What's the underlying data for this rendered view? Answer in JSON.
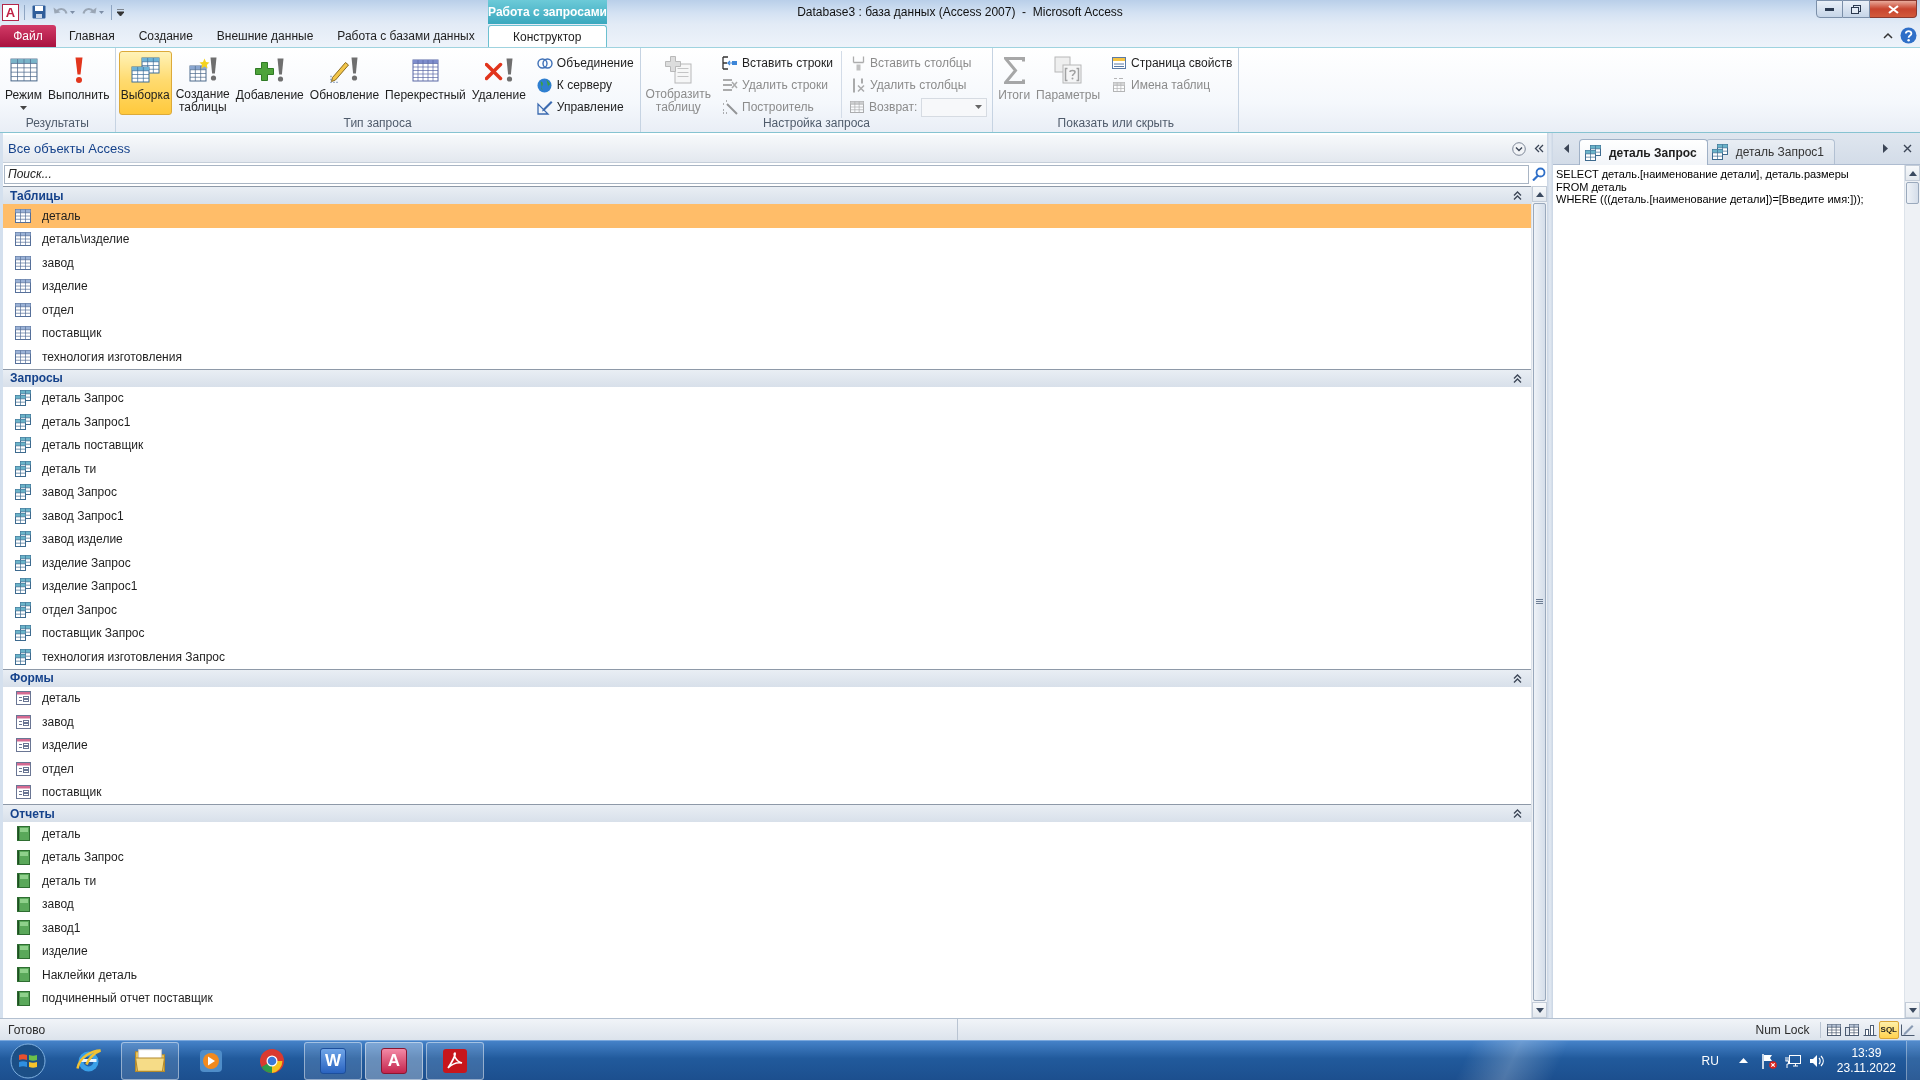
{
  "window": {
    "title": "Database3 : база данных (Access 2007)  -  Microsoft Access",
    "app_letter": "A"
  },
  "quick_access": [
    {
      "kind": "save",
      "disabled": false
    },
    {
      "kind": "undo",
      "disabled": true
    },
    {
      "kind": "redo",
      "disabled": true
    }
  ],
  "contextual_tab_group": {
    "label": "Работа с запросами"
  },
  "ribbon_tabs": [
    {
      "label": "Файл",
      "kind": "file",
      "selected": false
    },
    {
      "label": "Главная",
      "kind": "normal",
      "selected": false
    },
    {
      "label": "Создание",
      "kind": "normal",
      "selected": false
    },
    {
      "label": "Внешние данные",
      "kind": "normal",
      "selected": false
    },
    {
      "label": "Работа с базами данных",
      "kind": "normal",
      "selected": false
    },
    {
      "label": "Конструктор",
      "kind": "contextual",
      "selected": true
    }
  ],
  "ribbon_groups": [
    {
      "label": "Результаты",
      "buttons": [
        {
          "kind": "large",
          "label": "Режим",
          "dropdown": true,
          "disabled": false
        },
        {
          "kind": "large",
          "label": "Выполнить",
          "dropdown": false,
          "disabled": false
        }
      ]
    },
    {
      "label": "Тип запроса",
      "buttons": [
        {
          "kind": "large",
          "label": "Выборка",
          "selected": true,
          "disabled": false
        },
        {
          "kind": "large",
          "label": "Создание таблицы",
          "selected": false,
          "disabled": false
        },
        {
          "kind": "large",
          "label": "Добавление",
          "selected": false,
          "disabled": false
        },
        {
          "kind": "large",
          "label": "Обновление",
          "selected": false,
          "disabled": false
        },
        {
          "kind": "large",
          "label": "Перекрестный",
          "selected": false,
          "disabled": false
        },
        {
          "kind": "large",
          "label": "Удаление",
          "selected": false,
          "disabled": false
        },
        {
          "kind": "small",
          "label": "Объединение",
          "selected": false,
          "disabled": false
        },
        {
          "kind": "small",
          "label": "К серверу",
          "selected": false,
          "disabled": false
        },
        {
          "kind": "small",
          "label": "Управление",
          "selected": false,
          "disabled": false
        }
      ]
    },
    {
      "label": "Настройка запроса",
      "buttons": [
        {
          "kind": "large",
          "label": "Отобразить таблицу",
          "disabled": true
        },
        {
          "kind": "small",
          "label": "Вставить строки",
          "disabled": false
        },
        {
          "kind": "small",
          "label": "Удалить строки",
          "disabled": true
        },
        {
          "kind": "small",
          "label": "Построитель",
          "disabled": true
        },
        {
          "kind": "small",
          "label": "Вставить столбцы",
          "disabled": true
        },
        {
          "kind": "small",
          "label": "Удалить столбцы",
          "disabled": true
        },
        {
          "kind": "combo",
          "label": "Возврат:",
          "disabled": true
        }
      ]
    },
    {
      "label": "Показать или скрыть",
      "buttons": [
        {
          "kind": "large",
          "label": "Итоги",
          "disabled": true
        },
        {
          "kind": "large",
          "label": "Параметры",
          "disabled": true
        },
        {
          "kind": "small",
          "label": "Страница свойств",
          "disabled": false
        },
        {
          "kind": "small",
          "label": "Имена таблиц",
          "disabled": true
        }
      ]
    }
  ],
  "navigation_pane": {
    "title": "Все объекты Access",
    "search": {
      "placeholder": "Поиск..."
    },
    "groups": [
      {
        "label": "Таблицы",
        "kind": "table",
        "expanded": true,
        "items": [
          {
            "label": "деталь",
            "selected": true
          },
          {
            "label": "деталь\\изделие",
            "selected": false
          },
          {
            "label": "завод",
            "selected": false
          },
          {
            "label": "изделие",
            "selected": false
          },
          {
            "label": "отдел",
            "selected": false
          },
          {
            "label": "поставщик",
            "selected": false
          },
          {
            "label": "технология изготовления",
            "selected": false
          }
        ]
      },
      {
        "label": "Запросы",
        "kind": "query",
        "expanded": true,
        "items": [
          {
            "label": "деталь Запрос",
            "selected": false
          },
          {
            "label": "деталь Запрос1",
            "selected": false
          },
          {
            "label": "деталь поставщик",
            "selected": false
          },
          {
            "label": "деталь ти",
            "selected": false
          },
          {
            "label": "завод Запрос",
            "selected": false
          },
          {
            "label": "завод Запрос1",
            "selected": false
          },
          {
            "label": "завод изделие",
            "selected": false
          },
          {
            "label": "изделие Запрос",
            "selected": false
          },
          {
            "label": "изделие Запрос1",
            "selected": false
          },
          {
            "label": "отдел Запрос",
            "selected": false
          },
          {
            "label": "поставщик Запрос",
            "selected": false
          },
          {
            "label": "технология изготовления Запрос",
            "selected": false
          }
        ]
      },
      {
        "label": "Формы",
        "kind": "form",
        "expanded": true,
        "items": [
          {
            "label": "деталь",
            "selected": false
          },
          {
            "label": "завод",
            "selected": false
          },
          {
            "label": "изделие",
            "selected": false
          },
          {
            "label": "отдел",
            "selected": false
          },
          {
            "label": "поставщик",
            "selected": false
          }
        ]
      },
      {
        "label": "Отчеты",
        "kind": "report",
        "expanded": true,
        "items": [
          {
            "label": "деталь",
            "selected": false
          },
          {
            "label": "деталь Запрос",
            "selected": false
          },
          {
            "label": "деталь ти",
            "selected": false
          },
          {
            "label": "завод",
            "selected": false
          },
          {
            "label": "завод1",
            "selected": false
          },
          {
            "label": "изделие",
            "selected": false
          },
          {
            "label": "Наклейки деталь",
            "selected": false
          },
          {
            "label": "подчиненный отчет поставщик",
            "selected": false
          }
        ]
      }
    ]
  },
  "document_tabs": [
    {
      "label": "деталь Запрос",
      "selected": true
    },
    {
      "label": "деталь Запрос1",
      "selected": false
    }
  ],
  "sql_view": {
    "lines": [
      "SELECT деталь.[наименование детали], деталь.размеры",
      "FROM деталь",
      "WHERE (((деталь.[наименование детали])=[Введите имя:]));"
    ]
  },
  "status_bar": {
    "text": "Готово",
    "indicators": [
      "Num Lock"
    ],
    "views": [
      {
        "kind": "datasheet",
        "selected": false
      },
      {
        "kind": "pivot-table",
        "selected": false
      },
      {
        "kind": "pivot-chart",
        "selected": false
      },
      {
        "kind": "sql",
        "label": "SQL",
        "selected": true
      },
      {
        "kind": "design",
        "selected": false
      }
    ]
  },
  "taskbar": {
    "apps": [
      {
        "kind": "ie",
        "running": false,
        "active": false
      },
      {
        "kind": "explorer",
        "running": true,
        "active": false
      },
      {
        "kind": "media-player",
        "running": false,
        "active": false
      },
      {
        "kind": "chrome",
        "running": false,
        "active": false
      },
      {
        "kind": "word",
        "letter": "W",
        "running": true,
        "active": false
      },
      {
        "kind": "access",
        "letter": "A",
        "running": true,
        "active": true
      },
      {
        "kind": "acrobat",
        "running": true,
        "active": false
      }
    ],
    "language": "RU",
    "time": "13:39",
    "date": "23.11.2022"
  }
}
